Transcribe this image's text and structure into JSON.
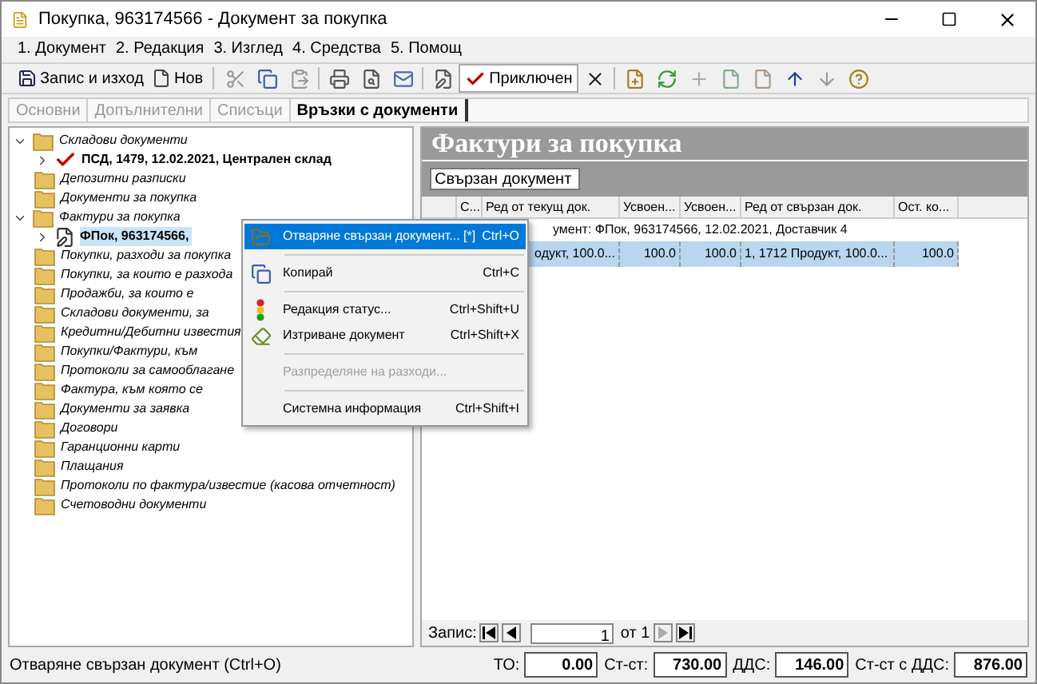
{
  "window": {
    "title": "Покупка, 963174566 - Документ за покупка"
  },
  "menu": [
    "1. Документ",
    "2. Редакция",
    "3. Изглед",
    "4. Средства",
    "5. Помощ"
  ],
  "toolbar": {
    "save": "Запис и изход",
    "new": "Нов",
    "done": "Приключен"
  },
  "tabs": [
    {
      "label": "Основни",
      "selected": false
    },
    {
      "label": "Допълнителни",
      "selected": false
    },
    {
      "label": "Списъци",
      "selected": false
    },
    {
      "label": "Връзки с документи",
      "selected": true
    }
  ],
  "tree": [
    {
      "label": "Складови документи",
      "expanded": true,
      "children": [
        {
          "label": "ПСД, 1479, 12.02.2021, Централен склад",
          "kind": "check",
          "selected": false
        }
      ]
    },
    {
      "label": "Депозитни разписки"
    },
    {
      "label": "Документи за покупка"
    },
    {
      "label": "Фактури за покупка",
      "expanded": true,
      "children": [
        {
          "label": "ФПок, 963174566,",
          "kind": "doc",
          "selected": true
        }
      ]
    },
    {
      "label": "Покупки, разходи за покупка"
    },
    {
      "label": "Покупки, за които е разхода"
    },
    {
      "label": "Продажби, за които е"
    },
    {
      "label": "Складови документи, за"
    },
    {
      "label": "Кредитни/Дебитни известия"
    },
    {
      "label": "Покупки/Фактури, към"
    },
    {
      "label": "Протоколи за самооблагане"
    },
    {
      "label": "Фактура, към която се"
    },
    {
      "label": "Документи за заявка"
    },
    {
      "label": "Договори"
    },
    {
      "label": "Гаранционни карти"
    },
    {
      "label": "Плащания"
    },
    {
      "label": "Протоколи по фактура/известие (касова отчетност)"
    },
    {
      "label": "Счетоводни документи"
    }
  ],
  "panel": {
    "title": "Фактури за покупка",
    "group_by": "Свързан документ",
    "columns": [
      "С...",
      "Ред от текущ док.",
      "Усвоен...",
      "Усвоен...",
      "Ред от свързан док.",
      "Ост. ко..."
    ],
    "group_row": "умент: ФПок, 963174566, 12.02.2021, Доставчик 4",
    "rows": [
      {
        "selected": true,
        "cells": [
          "",
          "одукт, 100.0...",
          "100.0",
          "100.0",
          "1, 1712 Продукт, 100.0...",
          "100.0"
        ]
      }
    ],
    "navigator": {
      "label": "Запис:",
      "page": "1",
      "of": "от 1"
    }
  },
  "context_menu": [
    {
      "label": "Отваряне свързан документ... [*]",
      "shortcut": "Ctrl+O",
      "selected": true,
      "disabled": false
    },
    {
      "kind": "separator"
    },
    {
      "label": "Копирай",
      "shortcut": "Ctrl+C",
      "selected": false,
      "disabled": false
    },
    {
      "kind": "separator"
    },
    {
      "label": "Редакция статус...",
      "shortcut": "Ctrl+Shift+U",
      "selected": false,
      "disabled": false
    },
    {
      "label": "Изтриване документ",
      "shortcut": "Ctrl+Shift+X",
      "selected": false,
      "disabled": false
    },
    {
      "kind": "separator"
    },
    {
      "label": "Разпределяне на разходи...",
      "selected": false,
      "disabled": true
    },
    {
      "kind": "separator"
    },
    {
      "label": "Системна информация",
      "shortcut": "Ctrl+Shift+I",
      "selected": false,
      "disabled": false
    }
  ],
  "status_bar": {
    "message": "Отваряне свързан документ (Ctrl+O)",
    "totals": [
      {
        "label": "ТО:",
        "value": "0.00"
      },
      {
        "label": "Ст-ст:",
        "value": "730.00"
      },
      {
        "label": "ДДС:",
        "value": "146.00"
      },
      {
        "label": "Ст-ст с ДДС:",
        "value": "876.00"
      }
    ]
  }
}
